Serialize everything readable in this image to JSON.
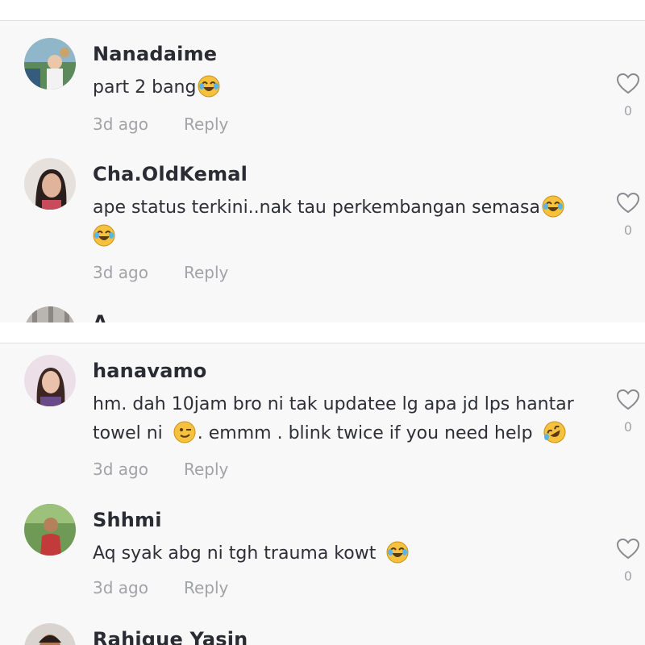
{
  "comments_top": [
    {
      "username": "Nanadaime",
      "text": "part 2 bang",
      "emoji": "joy",
      "time": "3d ago",
      "reply": "Reply",
      "likes": "0"
    },
    {
      "username": "Cha.OldKemal",
      "text": "ape status terkini..nak tau perkembangan semasa",
      "emoji": "joy",
      "time": "3d ago",
      "reply": "Reply",
      "likes": "0"
    },
    {
      "username": "A"
    }
  ],
  "comments_bottom": [
    {
      "username": "hanavamo",
      "text_line1": "hm. dah 10jam bro ni tak updatee lg apa jd lps hantar",
      "text_line2_a": "towel ni",
      "text_line2_b": ". emmm . blink twice if you need help",
      "time": "3d ago",
      "reply": "Reply",
      "likes": "0"
    },
    {
      "username": "Shhmi",
      "text": "Aq syak abg ni tgh trauma kowt",
      "time": "3d ago",
      "reply": "Reply",
      "likes": "0"
    },
    {
      "username": "Rahique Yasin"
    }
  ],
  "colors": {
    "background": "#f8f8f8",
    "username": "#2a2b33",
    "meta": "#a2a3a8",
    "emoji": "#f6c23e"
  },
  "icons": [
    "heart-outline-icon",
    "joy-emoji-icon",
    "winking-emoji-icon",
    "rofl-emoji-icon"
  ]
}
